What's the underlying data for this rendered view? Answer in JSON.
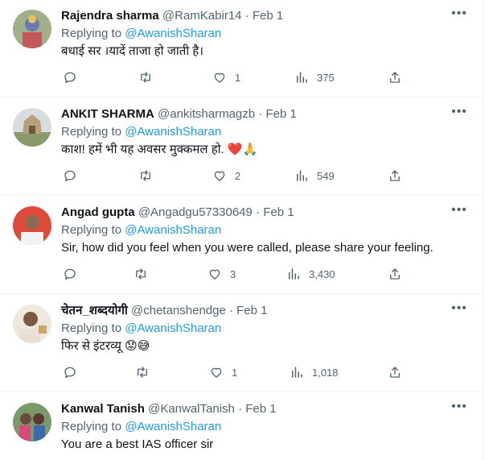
{
  "tweets": [
    {
      "name": "Rajendra sharma",
      "handle": "@RamKabir14",
      "date": "Feb 1",
      "replying_prefix": "Replying to",
      "replying_to": "@AwanishSharan",
      "text": "बधाई सर ।यादें ताजा हो जाती है।",
      "emoji": "",
      "likes": "1",
      "views": "375",
      "avatar_color": "#8a9a7a"
    },
    {
      "name": "ANKIT SHARMA",
      "handle": "@ankitsharmagzb",
      "date": "Feb 1",
      "replying_prefix": "Replying to",
      "replying_to": "@AwanishSharan",
      "text": "काश! हमें भी यह अवसर मुक्कमल हो.",
      "emoji": "❤️🙏",
      "likes": "2",
      "views": "549",
      "avatar_color": "#b9a77e"
    },
    {
      "name": "Angad gupta",
      "handle": "@Angadgu57330649",
      "date": "Feb 1",
      "replying_prefix": "Replying to",
      "replying_to": "@AwanishSharan",
      "text": "Sir, how did you feel when you were called, please share your feeling.",
      "emoji": "",
      "likes": "3",
      "views": "3,430",
      "avatar_color": "#d94a3a"
    },
    {
      "name": "चेतन_शब्दयोगी",
      "handle": "@chetanshendge",
      "date": "Feb 1",
      "replying_prefix": "Replying to",
      "replying_to": "@AwanishSharan",
      "text": "फिर से इंटरव्यू",
      "emoji": "😟😅",
      "likes": "1",
      "views": "1,018",
      "avatar_color": "#c9b28e"
    },
    {
      "name": "Kanwal Tanish",
      "handle": "@KanwalTanish",
      "date": "Feb 1",
      "replying_prefix": "Replying to",
      "replying_to": "@AwanishSharan",
      "text": "You are a best IAS officer sir",
      "emoji": "",
      "likes": "",
      "views": "",
      "avatar_color": "#6a8a5a"
    }
  ],
  "icons": {
    "reply": "reply-icon",
    "retweet": "retweet-icon",
    "like": "heart-icon",
    "views": "views-icon",
    "share": "share-icon",
    "more": "more-icon"
  },
  "colors": {
    "link": "#1d9bf0",
    "secondary": "#536471",
    "text": "#0f1419"
  }
}
